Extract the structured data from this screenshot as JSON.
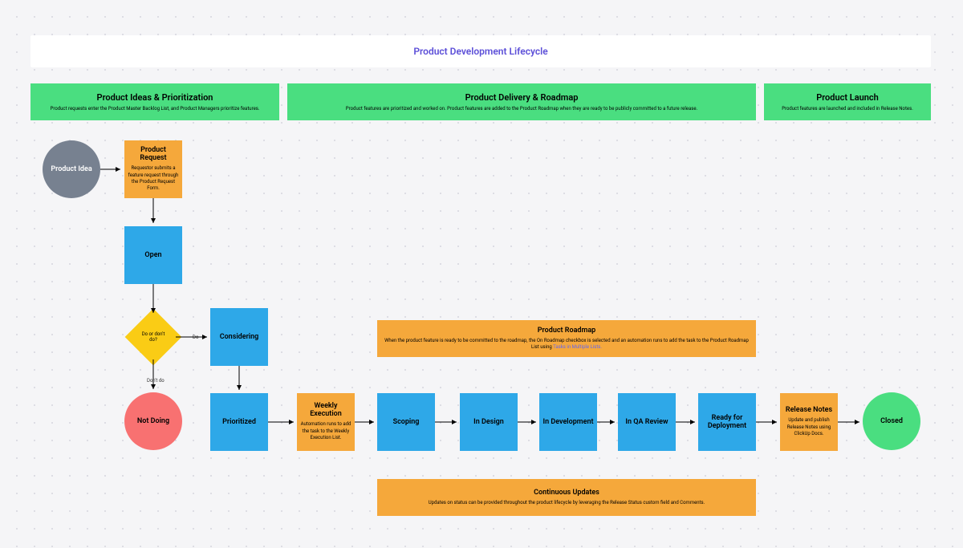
{
  "title": "Product Development Lifecycle",
  "sections": {
    "ideas": {
      "title": "Product Ideas & Prioritization",
      "sub": "Product requests enter the Product Master Backlog List, and Product Managers prioritize features."
    },
    "delivery": {
      "title": "Product Delivery & Roadmap",
      "sub": "Product features are prioritized and worked on. Product features are added to the Product Roadmap when they are ready to be publicly committed to a future release."
    },
    "launch": {
      "title": "Product Launch",
      "sub": "Product features are launched and included in Release Notes."
    }
  },
  "nodes": {
    "idea": "Product Idea",
    "request": {
      "title": "Product Request",
      "sub": "Requestor submits a feature request through the Product Request Form."
    },
    "open": "Open",
    "decision": "Do or don't do?",
    "decision_do": "Do",
    "decision_dont": "Don't do",
    "notdoing": "Not Doing",
    "considering": "Considering",
    "prioritized": "Prioritized",
    "weekly": {
      "title": "Weekly Execution",
      "sub": "Automation runs to add the task to the Weekly Execution List."
    },
    "scoping": "Scoping",
    "indesign": "In Design",
    "indev": "In Development",
    "inqa": "In QA Review",
    "ready": "Ready for Deployment",
    "notes": {
      "title": "Release Notes",
      "sub": "Update and publish Release Notes using ClickUp Docs."
    },
    "closed": "Closed",
    "roadmap": {
      "title": "Product Roadmap",
      "sub": "When the product feature is ready to be committed to the roadmap, the On Roadmap checkbox is selected and an automation runs to add the task to the Product Roadmap List using ",
      "link": "Tasks in Multiple Lists."
    },
    "continuous": {
      "title": "Continuous Updates",
      "sub": "Updates on status can be provided throughout the product lifecycle by leveraging the Release Status custom field and Comments."
    }
  }
}
